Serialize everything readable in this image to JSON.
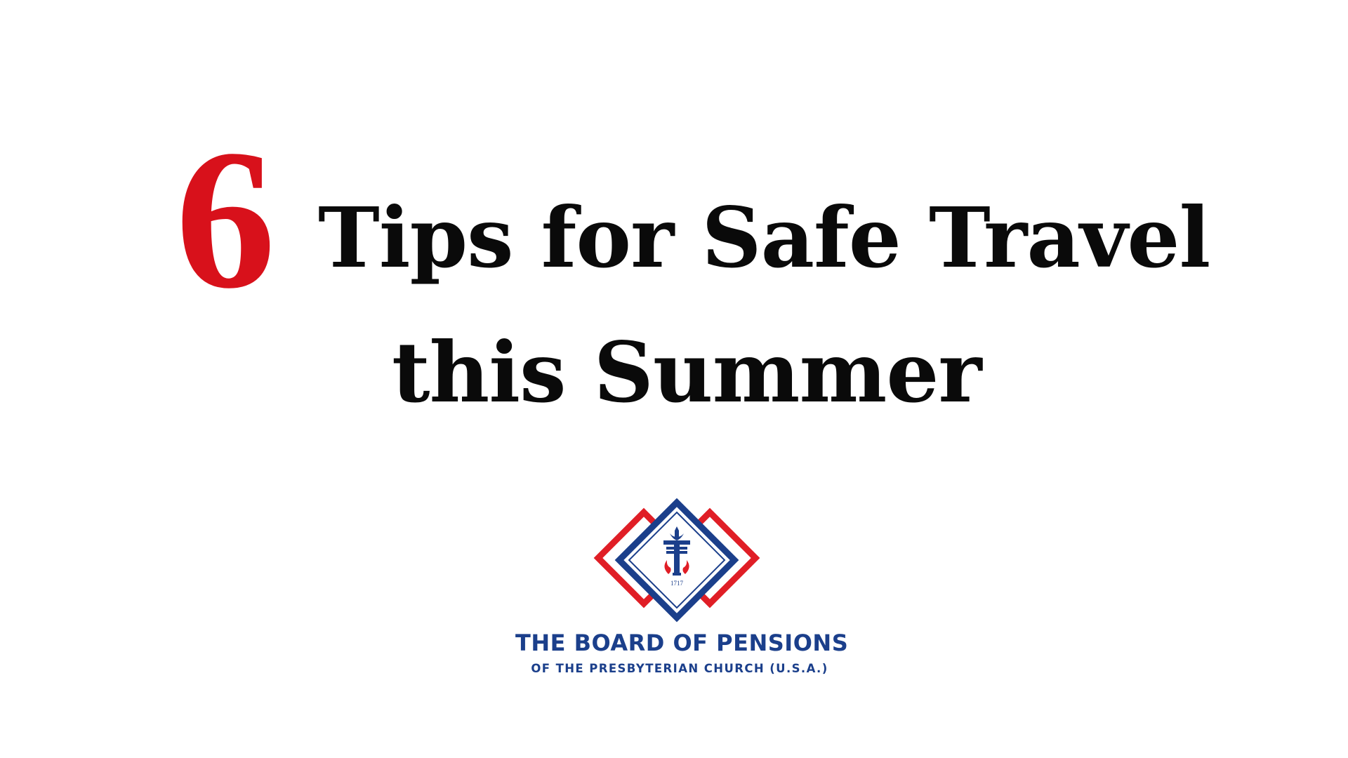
{
  "title": {
    "number": "6",
    "line1": "Tips for Safe Travel",
    "line2": "this Summer"
  },
  "logo": {
    "year": "1717",
    "icon": "presbyterian-seal-icon",
    "colors": {
      "red": "#e01e26",
      "blue": "#1b3f8b"
    }
  },
  "organization": {
    "name": "THE BOARD OF PENSIONS",
    "subtitle": "OF THE PRESBYTERIAN CHURCH (U.S.A.)"
  },
  "colors": {
    "accent": "#d8111b",
    "text": "#0a0a0a",
    "brand_blue": "#1b3f8b"
  }
}
